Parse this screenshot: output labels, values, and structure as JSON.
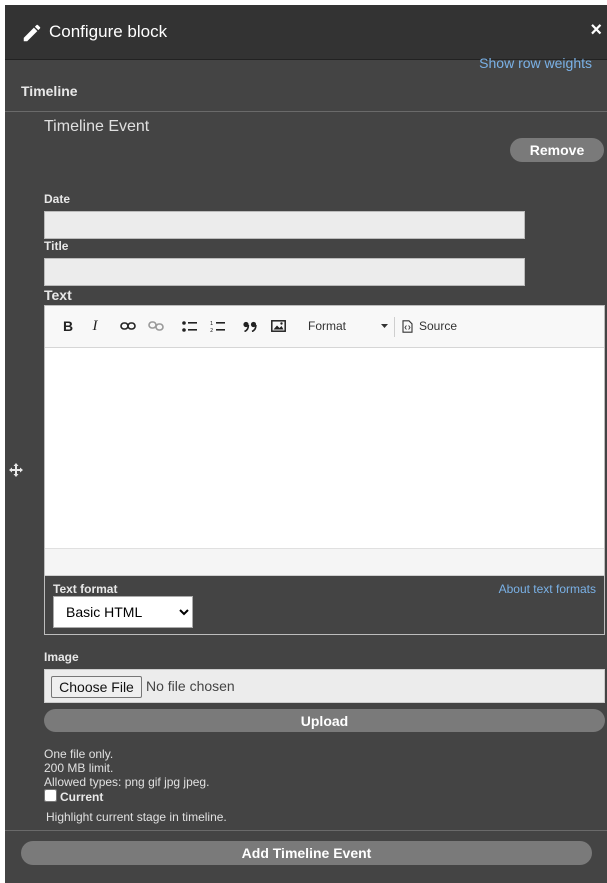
{
  "dialog": {
    "title": "Configure block",
    "close_icon": "×"
  },
  "links": {
    "row_weights": "Show row weights",
    "about_formats": "About text formats"
  },
  "section": {
    "title": "Timeline"
  },
  "event": {
    "title": "Timeline Event",
    "remove_label": "Remove"
  },
  "fields": {
    "date_label": "Date",
    "date_value": "",
    "title_label": "Title",
    "title_value": "",
    "text_label": "Text"
  },
  "toolbar": {
    "bold": "B",
    "italic": "I",
    "format_label": "Format",
    "source_label": "Source"
  },
  "text_format": {
    "label": "Text format",
    "selected": "Basic HTML",
    "options": [
      "Basic HTML"
    ]
  },
  "image": {
    "label": "Image",
    "choose_label": "Choose File",
    "no_file": "No file chosen",
    "upload_label": "Upload",
    "help": [
      "One file only.",
      "200 MB limit.",
      "Allowed types: png gif jpg jpeg."
    ]
  },
  "current": {
    "label": "Current",
    "checked": false,
    "description": "Highlight current stage in timeline."
  },
  "actions": {
    "add_label": "Add Timeline Event"
  },
  "colors": {
    "panel_bg": "#444444",
    "topbar_bg": "#333333",
    "link": "#7ab1e6",
    "pill_button": "#7a7a7a"
  },
  "icons": [
    "pencil-icon",
    "close-icon",
    "move-icon",
    "bold-icon",
    "italic-icon",
    "link-icon",
    "unlink-icon",
    "bulleted-list-icon",
    "numbered-list-icon",
    "blockquote-icon",
    "image-icon",
    "chevron-down-icon",
    "source-icon"
  ]
}
